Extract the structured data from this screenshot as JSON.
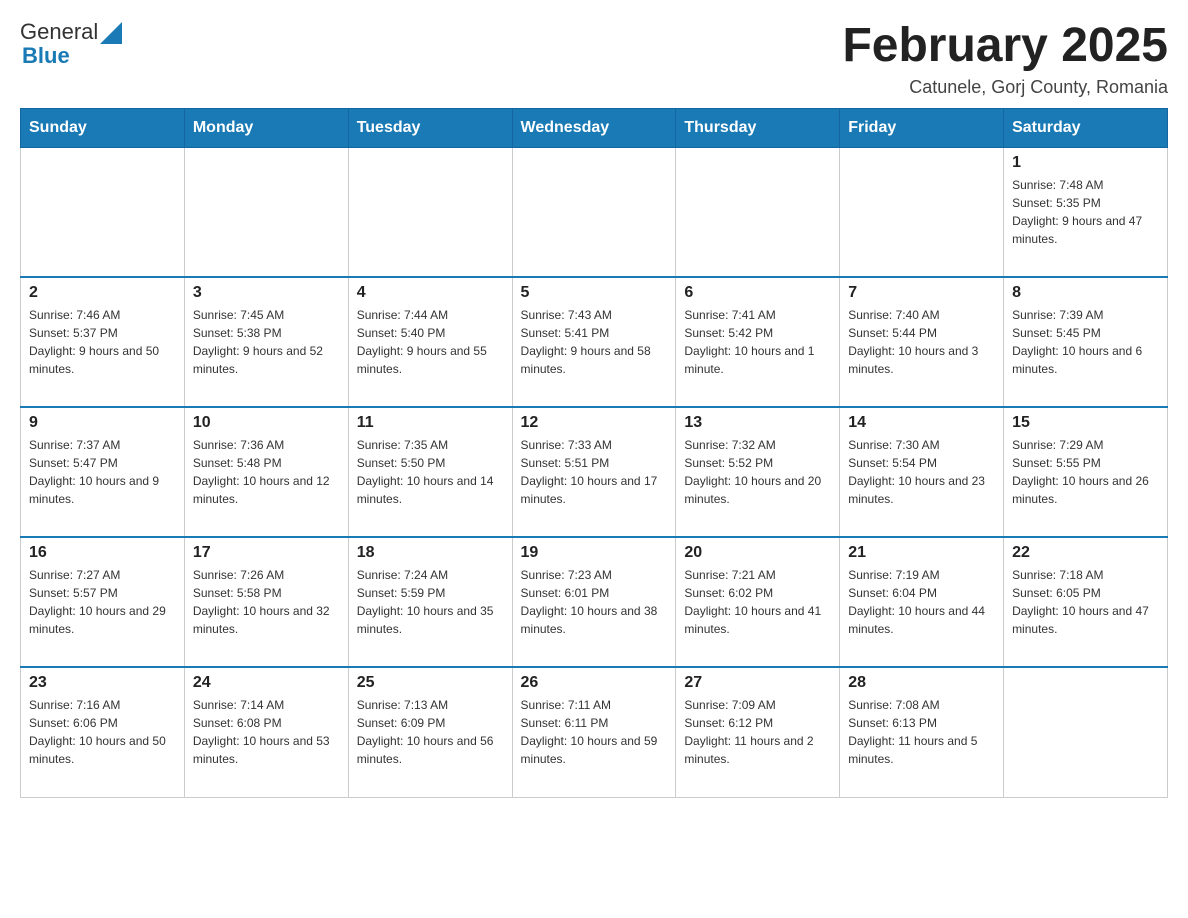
{
  "header": {
    "logo": {
      "text_general": "General",
      "text_blue": "Blue"
    },
    "title": "February 2025",
    "subtitle": "Catunele, Gorj County, Romania"
  },
  "days_of_week": [
    "Sunday",
    "Monday",
    "Tuesday",
    "Wednesday",
    "Thursday",
    "Friday",
    "Saturday"
  ],
  "weeks": [
    [
      {
        "day": "",
        "sunrise": "",
        "sunset": "",
        "daylight": ""
      },
      {
        "day": "",
        "sunrise": "",
        "sunset": "",
        "daylight": ""
      },
      {
        "day": "",
        "sunrise": "",
        "sunset": "",
        "daylight": ""
      },
      {
        "day": "",
        "sunrise": "",
        "sunset": "",
        "daylight": ""
      },
      {
        "day": "",
        "sunrise": "",
        "sunset": "",
        "daylight": ""
      },
      {
        "day": "",
        "sunrise": "",
        "sunset": "",
        "daylight": ""
      },
      {
        "day": "1",
        "sunrise": "Sunrise: 7:48 AM",
        "sunset": "Sunset: 5:35 PM",
        "daylight": "Daylight: 9 hours and 47 minutes."
      }
    ],
    [
      {
        "day": "2",
        "sunrise": "Sunrise: 7:46 AM",
        "sunset": "Sunset: 5:37 PM",
        "daylight": "Daylight: 9 hours and 50 minutes."
      },
      {
        "day": "3",
        "sunrise": "Sunrise: 7:45 AM",
        "sunset": "Sunset: 5:38 PM",
        "daylight": "Daylight: 9 hours and 52 minutes."
      },
      {
        "day": "4",
        "sunrise": "Sunrise: 7:44 AM",
        "sunset": "Sunset: 5:40 PM",
        "daylight": "Daylight: 9 hours and 55 minutes."
      },
      {
        "day": "5",
        "sunrise": "Sunrise: 7:43 AM",
        "sunset": "Sunset: 5:41 PM",
        "daylight": "Daylight: 9 hours and 58 minutes."
      },
      {
        "day": "6",
        "sunrise": "Sunrise: 7:41 AM",
        "sunset": "Sunset: 5:42 PM",
        "daylight": "Daylight: 10 hours and 1 minute."
      },
      {
        "day": "7",
        "sunrise": "Sunrise: 7:40 AM",
        "sunset": "Sunset: 5:44 PM",
        "daylight": "Daylight: 10 hours and 3 minutes."
      },
      {
        "day": "8",
        "sunrise": "Sunrise: 7:39 AM",
        "sunset": "Sunset: 5:45 PM",
        "daylight": "Daylight: 10 hours and 6 minutes."
      }
    ],
    [
      {
        "day": "9",
        "sunrise": "Sunrise: 7:37 AM",
        "sunset": "Sunset: 5:47 PM",
        "daylight": "Daylight: 10 hours and 9 minutes."
      },
      {
        "day": "10",
        "sunrise": "Sunrise: 7:36 AM",
        "sunset": "Sunset: 5:48 PM",
        "daylight": "Daylight: 10 hours and 12 minutes."
      },
      {
        "day": "11",
        "sunrise": "Sunrise: 7:35 AM",
        "sunset": "Sunset: 5:50 PM",
        "daylight": "Daylight: 10 hours and 14 minutes."
      },
      {
        "day": "12",
        "sunrise": "Sunrise: 7:33 AM",
        "sunset": "Sunset: 5:51 PM",
        "daylight": "Daylight: 10 hours and 17 minutes."
      },
      {
        "day": "13",
        "sunrise": "Sunrise: 7:32 AM",
        "sunset": "Sunset: 5:52 PM",
        "daylight": "Daylight: 10 hours and 20 minutes."
      },
      {
        "day": "14",
        "sunrise": "Sunrise: 7:30 AM",
        "sunset": "Sunset: 5:54 PM",
        "daylight": "Daylight: 10 hours and 23 minutes."
      },
      {
        "day": "15",
        "sunrise": "Sunrise: 7:29 AM",
        "sunset": "Sunset: 5:55 PM",
        "daylight": "Daylight: 10 hours and 26 minutes."
      }
    ],
    [
      {
        "day": "16",
        "sunrise": "Sunrise: 7:27 AM",
        "sunset": "Sunset: 5:57 PM",
        "daylight": "Daylight: 10 hours and 29 minutes."
      },
      {
        "day": "17",
        "sunrise": "Sunrise: 7:26 AM",
        "sunset": "Sunset: 5:58 PM",
        "daylight": "Daylight: 10 hours and 32 minutes."
      },
      {
        "day": "18",
        "sunrise": "Sunrise: 7:24 AM",
        "sunset": "Sunset: 5:59 PM",
        "daylight": "Daylight: 10 hours and 35 minutes."
      },
      {
        "day": "19",
        "sunrise": "Sunrise: 7:23 AM",
        "sunset": "Sunset: 6:01 PM",
        "daylight": "Daylight: 10 hours and 38 minutes."
      },
      {
        "day": "20",
        "sunrise": "Sunrise: 7:21 AM",
        "sunset": "Sunset: 6:02 PM",
        "daylight": "Daylight: 10 hours and 41 minutes."
      },
      {
        "day": "21",
        "sunrise": "Sunrise: 7:19 AM",
        "sunset": "Sunset: 6:04 PM",
        "daylight": "Daylight: 10 hours and 44 minutes."
      },
      {
        "day": "22",
        "sunrise": "Sunrise: 7:18 AM",
        "sunset": "Sunset: 6:05 PM",
        "daylight": "Daylight: 10 hours and 47 minutes."
      }
    ],
    [
      {
        "day": "23",
        "sunrise": "Sunrise: 7:16 AM",
        "sunset": "Sunset: 6:06 PM",
        "daylight": "Daylight: 10 hours and 50 minutes."
      },
      {
        "day": "24",
        "sunrise": "Sunrise: 7:14 AM",
        "sunset": "Sunset: 6:08 PM",
        "daylight": "Daylight: 10 hours and 53 minutes."
      },
      {
        "day": "25",
        "sunrise": "Sunrise: 7:13 AM",
        "sunset": "Sunset: 6:09 PM",
        "daylight": "Daylight: 10 hours and 56 minutes."
      },
      {
        "day": "26",
        "sunrise": "Sunrise: 7:11 AM",
        "sunset": "Sunset: 6:11 PM",
        "daylight": "Daylight: 10 hours and 59 minutes."
      },
      {
        "day": "27",
        "sunrise": "Sunrise: 7:09 AM",
        "sunset": "Sunset: 6:12 PM",
        "daylight": "Daylight: 11 hours and 2 minutes."
      },
      {
        "day": "28",
        "sunrise": "Sunrise: 7:08 AM",
        "sunset": "Sunset: 6:13 PM",
        "daylight": "Daylight: 11 hours and 5 minutes."
      },
      {
        "day": "",
        "sunrise": "",
        "sunset": "",
        "daylight": ""
      }
    ]
  ]
}
